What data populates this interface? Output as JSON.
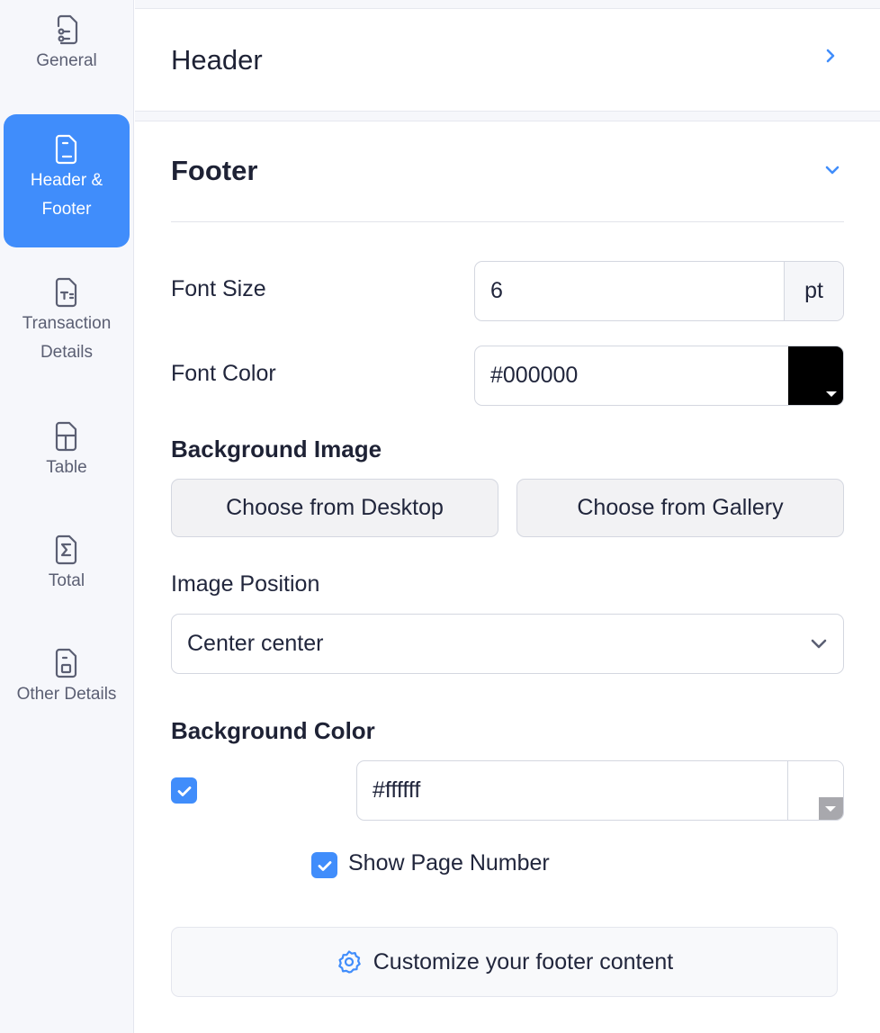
{
  "sidebar": {
    "items": [
      {
        "label": "General",
        "icon": "settings-document-icon",
        "active": false
      },
      {
        "label": "Header &\nFooter",
        "icon": "document-icon",
        "active": true
      },
      {
        "label": "Transaction\nDetails",
        "icon": "text-document-icon",
        "active": false
      },
      {
        "label": "Table",
        "icon": "table-icon",
        "active": false
      },
      {
        "label": "Total",
        "icon": "sigma-icon",
        "active": false
      },
      {
        "label": "Other Details",
        "icon": "image-document-icon",
        "active": false
      }
    ]
  },
  "header_section": {
    "title": "Header",
    "icon": "chevron-right-icon"
  },
  "footer_section": {
    "title": "Footer",
    "icon": "chevron-down-icon",
    "font_size": {
      "label": "Font Size",
      "value": "6",
      "unit": "pt"
    },
    "font_color": {
      "label": "Font Color",
      "value": "#000000",
      "swatch": "#000000"
    },
    "background_image": {
      "heading": "Background Image",
      "desktop_button": "Choose from Desktop",
      "gallery_button": "Choose from Gallery"
    },
    "image_position": {
      "label": "Image Position",
      "selected": "Center center"
    },
    "background_color": {
      "heading": "Background Color",
      "enabled": true,
      "value": "#ffffff"
    },
    "show_page_number": {
      "label": "Show Page Number",
      "checked": true
    },
    "customize_button": "Customize your footer content"
  },
  "colors": {
    "accent": "#408dfb",
    "text": "#21263c",
    "sidebar_bg": "#f6f7fb"
  }
}
